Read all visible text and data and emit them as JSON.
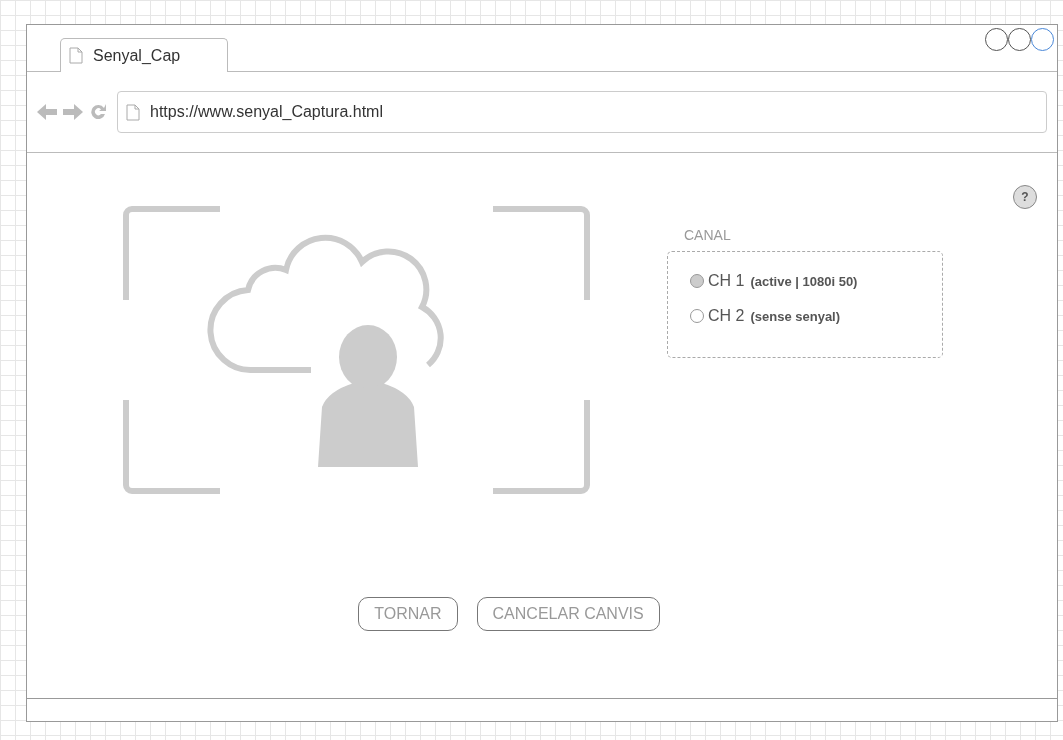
{
  "window": {
    "tab_title": "Senyal_Cap",
    "url": "https://www.senyal_Captura.html"
  },
  "channel_group": {
    "label": "CANAL",
    "options": [
      {
        "name": "CH 1",
        "detail": "(active | 1080i 50)",
        "selected": true
      },
      {
        "name": "CH 2",
        "detail": "(sense senyal)",
        "selected": false
      }
    ]
  },
  "help": "?",
  "buttons": [
    "TORNAR",
    "CANCELAR CANVIS"
  ]
}
